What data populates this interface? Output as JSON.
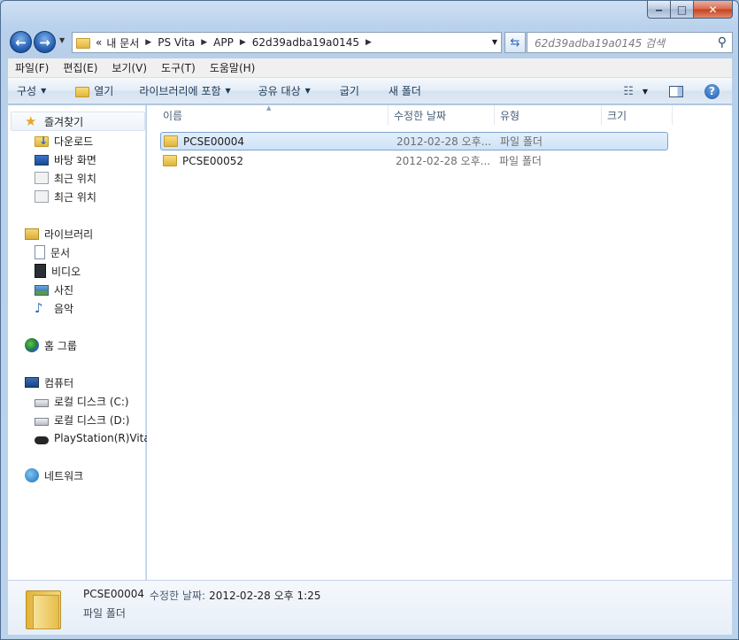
{
  "window": {
    "caption": {
      "minimize": "‒",
      "maximize": "□",
      "close": "✕"
    }
  },
  "nav": {
    "back_glyph": "←",
    "forward_glyph": "→",
    "breadcrumbs": [
      "«",
      "내 문서",
      "PS Vita",
      "APP",
      "62d39adba19a0145"
    ],
    "search_placeholder": "62d39adba19a0145 검색"
  },
  "menubar": [
    "파일(F)",
    "편집(E)",
    "보기(V)",
    "도구(T)",
    "도움말(H)"
  ],
  "toolbar": {
    "organize": "구성",
    "open": "열기",
    "include_library": "라이브러리에 포함",
    "share": "공유 대상",
    "burn": "굽기",
    "new_folder": "새 폴더"
  },
  "sidebar": {
    "favorites": "즐겨찾기",
    "favorites_items": [
      "다운로드",
      "바탕 화면",
      "최근 위치",
      "최근 위치"
    ],
    "libraries": "라이브러리",
    "library_items": [
      "문서",
      "비디오",
      "사진",
      "음악"
    ],
    "homegroup": "홈 그룹",
    "computer": "컴퓨터",
    "computer_items": [
      "로컬 디스크 (C:)",
      "로컬 디스크 (D:)",
      "PlayStation(R)Vita"
    ],
    "network": "네트워크"
  },
  "columns": {
    "name": "이름",
    "modified": "수정한 날짜",
    "type": "유형",
    "size": "크기"
  },
  "files": [
    {
      "name": "PCSE00004",
      "modified": "2012-02-28 오후...",
      "type": "파일 폴더",
      "selected": true
    },
    {
      "name": "PCSE00052",
      "modified": "2012-02-28 오후...",
      "type": "파일 폴더",
      "selected": false
    }
  ],
  "details": {
    "name": "PCSE00004",
    "modified_label": "수정한 날짜:",
    "modified_value": "2012-02-28 오후 1:25",
    "type": "파일 폴더"
  }
}
